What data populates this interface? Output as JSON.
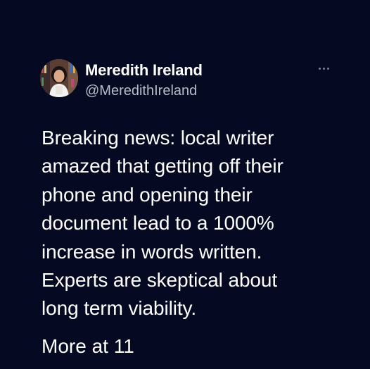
{
  "author": {
    "name": "Meredith Ireland",
    "handle": "@MeredithIreland"
  },
  "tweet": {
    "lines": [
      "Breaking news: local writer",
      "amazed that getting off their",
      "phone and opening their",
      "document lead to a 1000%",
      "increase in words written.",
      "Experts are skeptical about",
      "long term viability."
    ],
    "footer": "More at 11"
  },
  "icons": {
    "more": "more-horizontal-icon"
  },
  "colors": {
    "background": "#050a22",
    "text": "#ffffff",
    "secondary_text": "#b9bcc6",
    "icon": "#7c8092"
  }
}
